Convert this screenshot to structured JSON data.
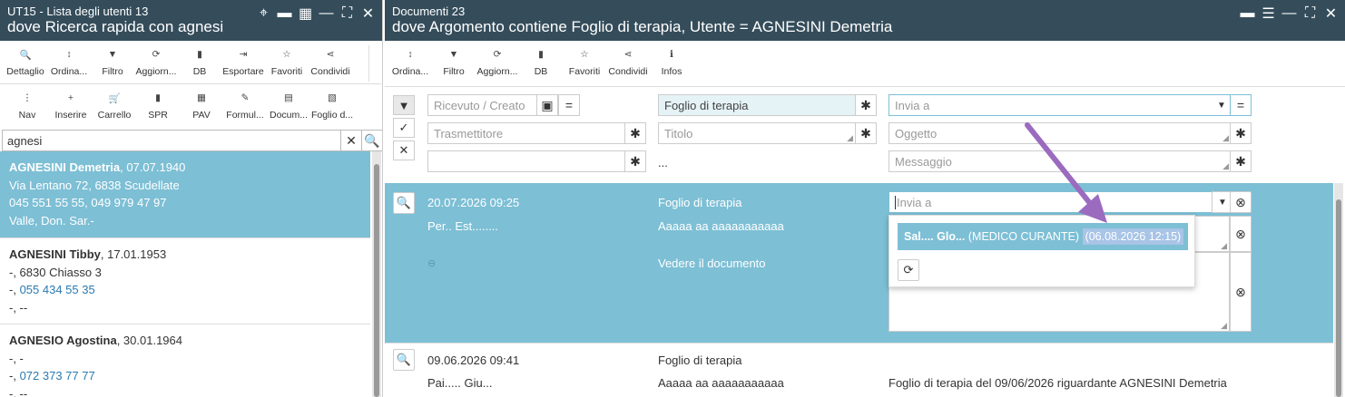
{
  "left": {
    "title": "UT15 - Lista degli utenti 13",
    "subtitle": "dove Ricerca rapida con agnesi",
    "toolbar1": [
      {
        "label": "Dettaglio",
        "icon": "search-icon",
        "glyph": "🔍"
      },
      {
        "label": "Ordina...",
        "icon": "sort-icon",
        "glyph": "↕"
      },
      {
        "label": "Filtro",
        "icon": "filter-icon",
        "glyph": "▼"
      },
      {
        "label": "Aggiorn...",
        "icon": "refresh-icon",
        "glyph": "⟳"
      },
      {
        "label": "DB",
        "icon": "bar-chart-icon",
        "glyph": "▮"
      },
      {
        "label": "Esportare",
        "icon": "export-icon",
        "glyph": "⇥"
      },
      {
        "label": "Favoriti",
        "icon": "star-icon",
        "glyph": "☆"
      },
      {
        "label": "Condividi",
        "icon": "share-icon",
        "glyph": "⋖"
      }
    ],
    "toolbar2": [
      {
        "label": "Nav",
        "icon": "more-vertical-icon",
        "glyph": "⋮"
      },
      {
        "label": "Inserire",
        "icon": "plus-icon",
        "glyph": "+"
      },
      {
        "label": "Carrello",
        "icon": "cart-icon",
        "glyph": "🛒"
      },
      {
        "label": "SPR",
        "icon": "bar-chart-icon",
        "glyph": "▮"
      },
      {
        "label": "PAV",
        "icon": "grid-icon",
        "glyph": "▦"
      },
      {
        "label": "Formul...",
        "icon": "edit-icon",
        "glyph": "✎"
      },
      {
        "label": "Docum...",
        "icon": "document-icon",
        "glyph": "▤"
      },
      {
        "label": "Foglio d...",
        "icon": "sheet-icon",
        "glyph": "▧"
      }
    ],
    "search_value": "agnesi",
    "patients": [
      {
        "name": "AGNESINI Demetria",
        "dob": ", 07.07.1940",
        "address": "Via Lentano 72, 6838 Scudellate",
        "phone": "045 551 55 55, 049 979 47 97",
        "extra": "Valle, Don. Sar.-"
      },
      {
        "name": "AGNESINI Tibby",
        "dob": ", 17.01.1953",
        "address": "-, 6830 Chiasso 3",
        "phone_prefix": "-, ",
        "phone": "055 434 55 35",
        "extra": "-, --"
      },
      {
        "name": "AGNESIO Agostina",
        "dob": ", 30.01.1964",
        "address": "-, -",
        "phone_prefix": "-, ",
        "phone": "072 373 77 77",
        "extra": "-, --"
      }
    ]
  },
  "right": {
    "title": "Documenti 23",
    "subtitle": "dove Argomento contiene Foglio di terapia, Utente = AGNESINI Demetria",
    "toolbar": [
      {
        "label": "Ordina...",
        "icon": "sort-icon",
        "glyph": "↕"
      },
      {
        "label": "Filtro",
        "icon": "filter-icon",
        "glyph": "▼"
      },
      {
        "label": "Aggiorn...",
        "icon": "refresh-icon",
        "glyph": "⟳"
      },
      {
        "label": "DB",
        "icon": "bar-chart-icon",
        "glyph": "▮"
      },
      {
        "label": "Favoriti",
        "icon": "star-icon",
        "glyph": "☆"
      },
      {
        "label": "Condividi",
        "icon": "share-icon",
        "glyph": "⋖"
      },
      {
        "label": "Infos",
        "icon": "info-icon",
        "glyph": "ℹ"
      }
    ],
    "filters": {
      "ricevuto_placeholder": "Ricevuto / Creato",
      "argomento_value": "Foglio di terapia",
      "invia_a_placeholder": "Invia a",
      "trasmettitore_placeholder": "Trasmettitore",
      "titolo_placeholder": "Titolo",
      "oggetto_placeholder": "Oggetto",
      "messaggio_placeholder": "Messaggio",
      "ellipsis": "...",
      "eq": "=",
      "star": "✱"
    },
    "rows": [
      {
        "date": "20.07.2026 09:25",
        "sender": "Per.. Est........",
        "topic": "Foglio di terapia",
        "title": "Aaaaa aa aaaaaaaaaaa",
        "link": "Vedere il documento",
        "invia_placeholder": "Invia a"
      },
      {
        "date": "09.06.2026 09:41",
        "sender": "Pai..... Giu...",
        "topic": "Foglio di terapia",
        "title": "Aaaaa aa aaaaaaaaaaa",
        "subject": "Foglio di terapia del 09/06/2026 riguardante AGNESINI Demetria"
      }
    ],
    "dropdown": {
      "name": "Sal.... Glo...",
      "role": " (MEDICO CURANTE) ",
      "date": "(06.08.2026 12:15)"
    }
  },
  "colors": {
    "titlebar": "#354d5b",
    "selected": "#7dbfd5",
    "link": "#2a7ab0",
    "arrow": "#9b6bbf"
  }
}
